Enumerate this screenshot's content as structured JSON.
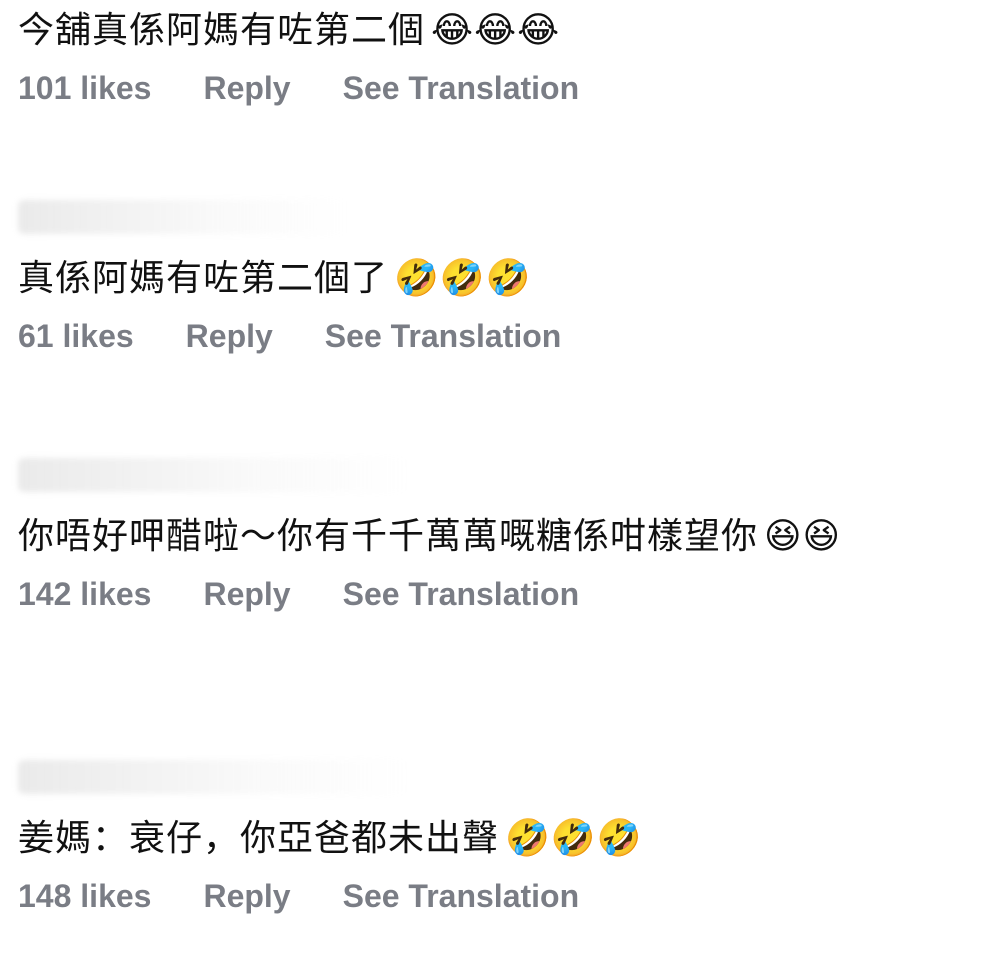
{
  "comments": [
    {
      "text": "今舖真係阿媽有咗第二個",
      "emoji": "😂😂😂",
      "likes": "101 likes",
      "reply": "Reply",
      "translate": "See Translation"
    },
    {
      "text": "真係阿媽有咗第二個了",
      "emoji": "🤣🤣🤣",
      "likes": "61 likes",
      "reply": "Reply",
      "translate": "See Translation"
    },
    {
      "text": "你唔好呷醋啦～你有千千萬萬嘅糖係咁樣望你",
      "emoji": "😆😆",
      "likes": "142 likes",
      "reply": "Reply",
      "translate": "See Translation"
    },
    {
      "text": "姜媽：衰仔，你亞爸都未出聲",
      "emoji": "🤣🤣🤣",
      "likes": "148 likes",
      "reply": "Reply",
      "translate": "See Translation"
    }
  ]
}
